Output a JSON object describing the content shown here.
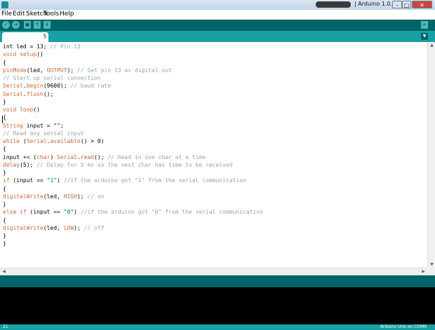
{
  "window": {
    "title": "| Arduino 1.0.5",
    "minimize_glyph": "–",
    "maximize_glyph": "□",
    "close_glyph": "✕"
  },
  "menu": [
    "File",
    "Edit",
    "Sketch",
    "Tools",
    "Help"
  ],
  "toolbar": {
    "verify_glyph": "✓",
    "upload_glyph": "→",
    "new_glyph": "▣",
    "open_glyph": "↑",
    "save_glyph": "↓",
    "serial_glyph": "⌕"
  },
  "tab": {
    "label": "§",
    "menu_glyph": "▼"
  },
  "editor": {
    "lines": [
      {
        "segs": [
          {
            "t": "int led = 13; "
          },
          {
            "t": "// Pin 13",
            "c": "cm"
          }
        ]
      },
      {
        "segs": [
          {
            "t": "void",
            "c": "kw"
          },
          {
            "t": " "
          },
          {
            "t": "setup",
            "c": "fn"
          },
          {
            "t": "()"
          }
        ]
      },
      {
        "segs": [
          {
            "t": "{"
          }
        ]
      },
      {
        "segs": [
          {
            "t": "pinMode",
            "c": "fn"
          },
          {
            "t": "(led, "
          },
          {
            "t": "OUTPUT",
            "c": "kw"
          },
          {
            "t": "); "
          },
          {
            "t": "// Set pin 13 as digital out",
            "c": "cm"
          }
        ]
      },
      {
        "segs": [
          {
            "t": "// Start up serial connection",
            "c": "cm"
          }
        ]
      },
      {
        "segs": [
          {
            "t": "Serial",
            "c": "kw"
          },
          {
            "t": "."
          },
          {
            "t": "begin",
            "c": "fn"
          },
          {
            "t": "(9600); "
          },
          {
            "t": "// baud rate",
            "c": "cm"
          }
        ]
      },
      {
        "segs": [
          {
            "t": "Serial",
            "c": "kw"
          },
          {
            "t": "."
          },
          {
            "t": "flush",
            "c": "fn"
          },
          {
            "t": "();"
          }
        ]
      },
      {
        "segs": [
          {
            "t": "}"
          }
        ]
      },
      {
        "segs": [
          {
            "t": "void",
            "c": "kw"
          },
          {
            "t": " "
          },
          {
            "t": "loop",
            "c": "fn"
          },
          {
            "t": "()"
          }
        ]
      },
      {
        "segs": [
          {
            "t": "{"
          }
        ]
      },
      {
        "segs": [
          {
            "t": "String",
            "c": "kw"
          },
          {
            "t": " input = \"\";"
          }
        ]
      },
      {
        "segs": [
          {
            "t": "// Read any serial input",
            "c": "cm"
          }
        ]
      },
      {
        "segs": [
          {
            "t": "while",
            "c": "kw"
          },
          {
            "t": " ("
          },
          {
            "t": "Serial",
            "c": "kw"
          },
          {
            "t": "."
          },
          {
            "t": "available",
            "c": "fn"
          },
          {
            "t": "() > 0)"
          }
        ]
      },
      {
        "segs": [
          {
            "t": "{"
          }
        ]
      },
      {
        "segs": [
          {
            "t": "input += ("
          },
          {
            "t": "char",
            "c": "kw"
          },
          {
            "t": ") "
          },
          {
            "t": "Serial",
            "c": "kw"
          },
          {
            "t": "."
          },
          {
            "t": "read",
            "c": "fn"
          },
          {
            "t": "(); "
          },
          {
            "t": "// Read in one char at a time",
            "c": "cm"
          }
        ]
      },
      {
        "segs": [
          {
            "t": "delay",
            "c": "fn"
          },
          {
            "t": "(5); "
          },
          {
            "t": "// Delay for 5 ms so the next char has time to be received",
            "c": "cm"
          }
        ]
      },
      {
        "segs": [
          {
            "t": "}"
          }
        ]
      },
      {
        "segs": [
          {
            "t": "if",
            "c": "kw"
          },
          {
            "t": " (input == "
          },
          {
            "t": "\"1\"",
            "c": "str"
          },
          {
            "t": ") "
          },
          {
            "t": "//if the arduino got \"1\" from the serial communication",
            "c": "cm"
          }
        ]
      },
      {
        "segs": [
          {
            "t": "{"
          }
        ]
      },
      {
        "segs": [
          {
            "t": "digitalWrite",
            "c": "fn"
          },
          {
            "t": "(led, "
          },
          {
            "t": "HIGH",
            "c": "kw"
          },
          {
            "t": "); "
          },
          {
            "t": "// on",
            "c": "cm"
          }
        ]
      },
      {
        "segs": [
          {
            "t": "}"
          }
        ]
      },
      {
        "segs": [
          {
            "t": "else",
            "c": "kw"
          },
          {
            "t": " "
          },
          {
            "t": "if",
            "c": "kw"
          },
          {
            "t": " (input == "
          },
          {
            "t": "\"0\"",
            "c": "str"
          },
          {
            "t": ") "
          },
          {
            "t": "//if the arduino got \"0\" from the serial communication",
            "c": "cm"
          }
        ]
      },
      {
        "segs": [
          {
            "t": "{"
          }
        ]
      },
      {
        "segs": [
          {
            "t": "digitalWrite",
            "c": "fn"
          },
          {
            "t": "(led, "
          },
          {
            "t": "LOW",
            "c": "kw"
          },
          {
            "t": "); "
          },
          {
            "t": "// off",
            "c": "cm"
          }
        ]
      },
      {
        "segs": [
          {
            "t": "}"
          }
        ]
      },
      {
        "segs": [
          {
            "t": "}"
          }
        ]
      }
    ]
  },
  "scrollbar": {
    "up_glyph": "▲",
    "down_glyph": "▼",
    "left_glyph": "◀",
    "right_glyph": "▶"
  },
  "status": {
    "line_number": "21",
    "board": "Arduino Uno on COM6"
  },
  "colors": {
    "toolbar": "#006468",
    "tabbar": "#17a1a5",
    "console": "#000000",
    "keyword": "#cc6633",
    "comment": "#95a5a6"
  }
}
